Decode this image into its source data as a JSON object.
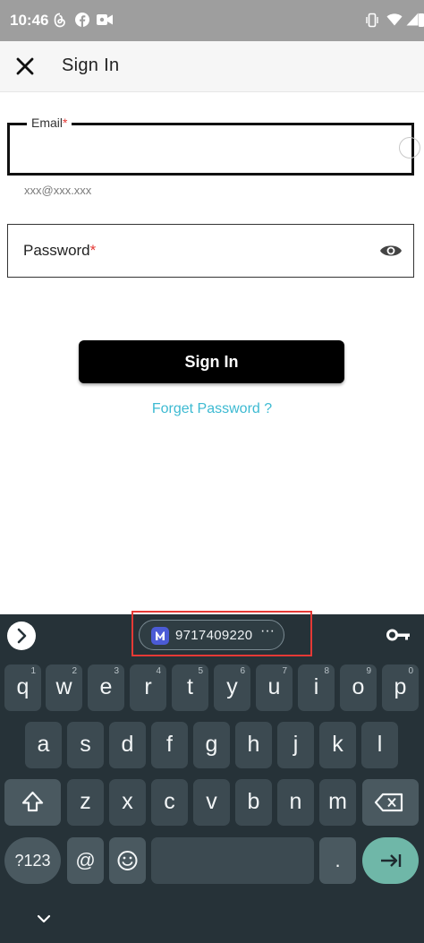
{
  "status_bar": {
    "time": "10:46",
    "left_icons": [
      "threads-icon",
      "facebook-icon",
      "video-camera-icon"
    ],
    "right_icons": [
      "vibrate-icon",
      "wifi-icon",
      "signal-icon",
      "battery-icon"
    ]
  },
  "app_bar": {
    "close_icon": "close-icon",
    "title": "Sign In"
  },
  "form": {
    "email": {
      "label": "Email",
      "required_mark": "*",
      "value": "",
      "hint": "xxx@xxx.xxx"
    },
    "password": {
      "label": "Password",
      "required_mark": "*",
      "toggle_icon": "eye-icon"
    },
    "signin_label": "Sign In",
    "forget_password": "Forget Password ?"
  },
  "colors": {
    "accent_link": "#3dbad2",
    "required": "#e53935",
    "keyboard_bg": "#263238",
    "enter_key": "#6fb7a8"
  },
  "keyboard": {
    "suggestion": {
      "value": "9717409220",
      "more": "···",
      "logo_icon": "app-logo-icon"
    },
    "row1": [
      {
        "label": "q",
        "hint": "1"
      },
      {
        "label": "w",
        "hint": "2"
      },
      {
        "label": "e",
        "hint": "3"
      },
      {
        "label": "r",
        "hint": "4"
      },
      {
        "label": "t",
        "hint": "5"
      },
      {
        "label": "y",
        "hint": "6"
      },
      {
        "label": "u",
        "hint": "7"
      },
      {
        "label": "i",
        "hint": "8"
      },
      {
        "label": "o",
        "hint": "9"
      },
      {
        "label": "p",
        "hint": "0"
      }
    ],
    "row2": [
      "a",
      "s",
      "d",
      "f",
      "g",
      "h",
      "j",
      "k",
      "l"
    ],
    "row3": [
      "z",
      "x",
      "c",
      "v",
      "b",
      "n",
      "m"
    ],
    "symbols_label": "?123",
    "at_label": "@",
    "period_label": "."
  }
}
